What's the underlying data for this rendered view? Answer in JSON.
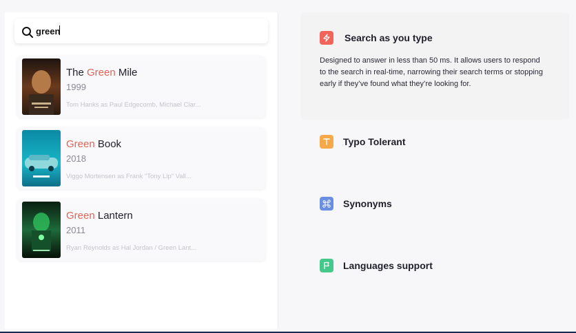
{
  "search": {
    "value": "green"
  },
  "results": [
    {
      "title_prefix": "The ",
      "title_highlight": "Green",
      "title_suffix": " Mile",
      "year": "1999",
      "cast": "Tom Hanks as Paul Edgecomb, Michael Clar..."
    },
    {
      "title_prefix": "",
      "title_highlight": "Green",
      "title_suffix": " Book",
      "year": "2018",
      "cast": "Viggo Mortensen as Frank \"Tony Lip\" Vall..."
    },
    {
      "title_prefix": "",
      "title_highlight": "Green",
      "title_suffix": " Lantern",
      "year": "2011",
      "cast": "Ryan Reynolds as Hal Jordan / Green Lant..."
    }
  ],
  "features": [
    {
      "title": "Search as you type",
      "icon": "lightning-icon",
      "color": "#f0645a",
      "description": "Designed to answer in less than 50 ms. It allows users to respond to the search in real-time, narrowing their search terms or stopping early if they’ve found what they’re looking for."
    },
    {
      "title": "Typo Tolerant",
      "icon": "text-t-icon",
      "color": "#f5a94a"
    },
    {
      "title": "Synonyms",
      "icon": "command-icon",
      "color": "#6b8fe0"
    },
    {
      "title": "Languages support",
      "icon": "flag-icon",
      "color": "#44c98a"
    }
  ],
  "colors": {
    "highlight": "#e06457",
    "background": "#f7f7f9"
  }
}
